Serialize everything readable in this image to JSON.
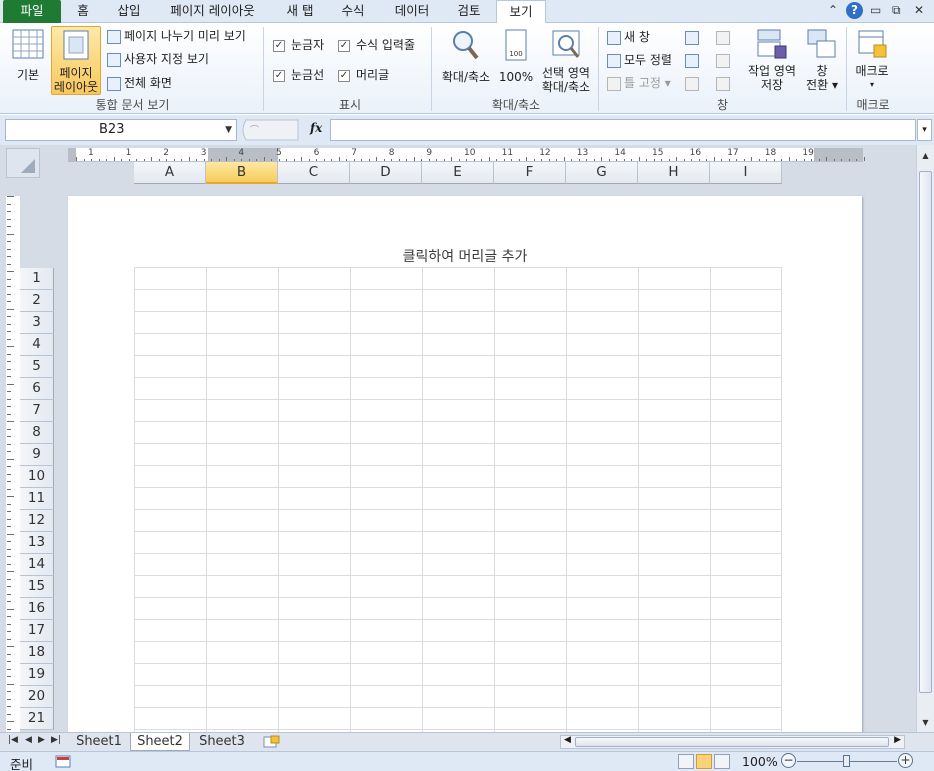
{
  "ribbon_tabs": [
    "파일",
    "홈",
    "삽입",
    "페이지 레이아웃",
    "새 탭",
    "수식",
    "데이터",
    "검토",
    "보기"
  ],
  "active_tab": "보기",
  "ribbon": {
    "workbook_views": {
      "normal": "기본",
      "page_layout_1": "페이지",
      "page_layout_2": "레이아웃",
      "page_break_preview": "페이지 나누기 미리 보기",
      "custom_views": "사용자 지정 보기",
      "full_screen": "전체 화면",
      "group_label": "통합 문서 보기"
    },
    "show": {
      "ruler": "눈금자",
      "formula_bar": "수식 입력줄",
      "gridlines": "눈금선",
      "headings": "머리글",
      "ruler_checked": true,
      "formula_bar_checked": true,
      "gridlines_checked": true,
      "headings_checked": true,
      "group_label": "표시"
    },
    "zoom": {
      "zoom": "확대/축소",
      "hundred": "100%",
      "to_selection_1": "선택 영역",
      "to_selection_2": "확대/축소",
      "group_label": "확대/축소"
    },
    "window": {
      "new_window": "새 창",
      "arrange_all": "모두 정렬",
      "freeze_panes": "틀 고정",
      "save_workspace_1": "작업 영역",
      "save_workspace_2": "저장",
      "switch_windows_1": "창",
      "switch_windows_2": "전환",
      "group_label": "창"
    },
    "macros": {
      "macros": "매크로",
      "group_label": "매크로"
    }
  },
  "formula_bar": {
    "name_box": "B23",
    "fx": "fx",
    "formula": ""
  },
  "sheet": {
    "columns": [
      "A",
      "B",
      "C",
      "D",
      "E",
      "F",
      "G",
      "H",
      "I"
    ],
    "selected_column": "B",
    "rows": [
      "1",
      "2",
      "3",
      "4",
      "5",
      "6",
      "7",
      "8",
      "9",
      "10",
      "11",
      "12",
      "13",
      "14",
      "15",
      "16",
      "17",
      "18",
      "19",
      "20",
      "21"
    ],
    "header_hint": "클릭하여 머리글 추가",
    "ruler_numbers": [
      "1",
      "1",
      "2",
      "3",
      "4",
      "5",
      "6",
      "7",
      "8",
      "9",
      "10",
      "11",
      "12",
      "13",
      "14",
      "15",
      "16",
      "17",
      "18",
      "19"
    ]
  },
  "sheet_tabs": [
    "Sheet1",
    "Sheet2",
    "Sheet3"
  ],
  "active_sheet": "Sheet2",
  "status": {
    "ready": "준비",
    "zoom": "100%"
  },
  "colors": {
    "file_tab": "#1f7a34",
    "active_button": "#f8c85c",
    "ribbon_bg": "#dfe9f5"
  }
}
